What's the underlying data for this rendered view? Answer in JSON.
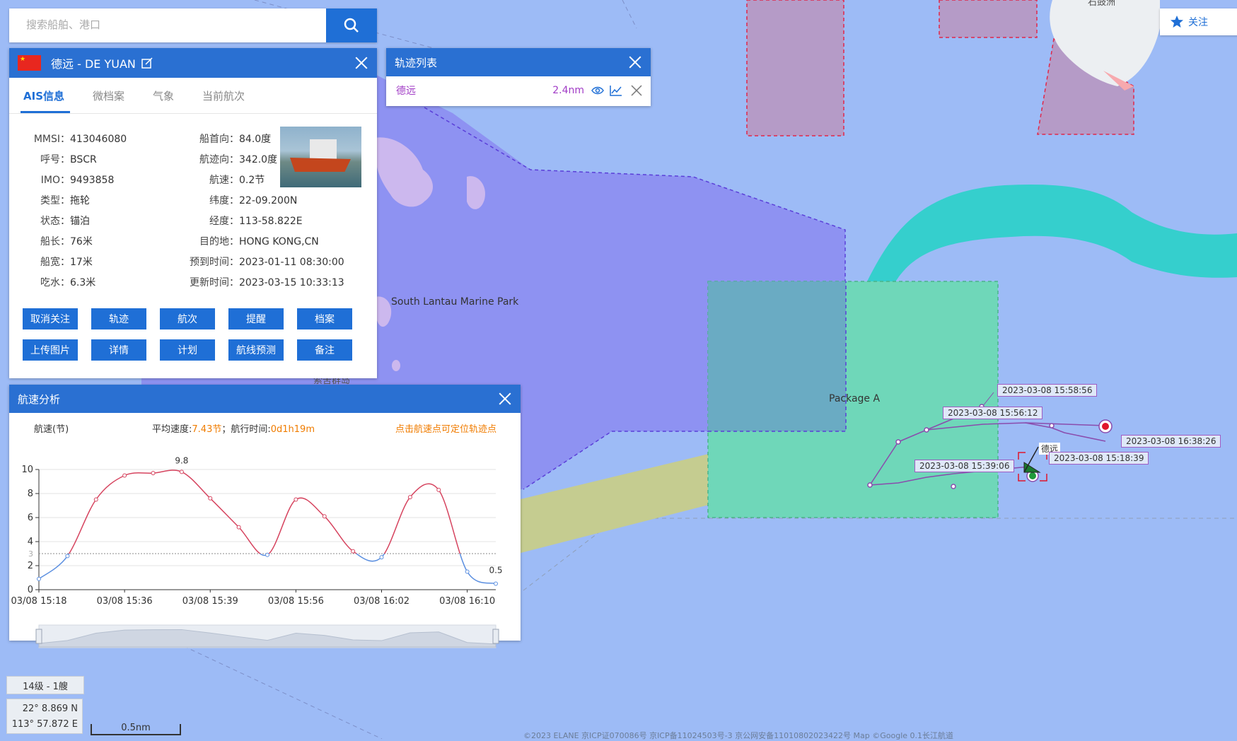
{
  "search": {
    "placeholder": "搜索船舶、港口"
  },
  "ship_panel": {
    "title": "德远 -  DE YUAN",
    "tabs": [
      "AIS信息",
      "微档案",
      "气象",
      "当前航次"
    ],
    "fields": {
      "mmsi": {
        "label": "MMSI：",
        "value": "413046080"
      },
      "callsign": {
        "label": "呼号：",
        "value": "BSCR"
      },
      "imo": {
        "label": "IMO：",
        "value": "9493858"
      },
      "type": {
        "label": "类型：",
        "value": "拖轮"
      },
      "status": {
        "label": "状态：",
        "value": "锚泊"
      },
      "length": {
        "label": "船长：",
        "value": "76米"
      },
      "beam": {
        "label": "船宽：",
        "value": "17米"
      },
      "draft": {
        "label": "吃水：",
        "value": "6.3米"
      },
      "heading": {
        "label": "船首向：",
        "value": "84.0度"
      },
      "course": {
        "label": "航迹向：",
        "value": "342.0度"
      },
      "speed": {
        "label": "航速：",
        "value": "0.2节"
      },
      "lat": {
        "label": "纬度：",
        "value": "22-09.200N"
      },
      "lon": {
        "label": "经度：",
        "value": "113-58.822E"
      },
      "destination": {
        "label": "目的地：",
        "value": "HONG KONG,CN"
      },
      "eta": {
        "label": "预到时间：",
        "value": "2023-01-11 08:30:00"
      },
      "updated": {
        "label": "更新时间：",
        "value": "2023-03-15 10:33:13"
      }
    },
    "buttons": [
      "取消关注",
      "轨迹",
      "航次",
      "提醒",
      "档案",
      "上传图片",
      "详情",
      "计划",
      "航线预测",
      "备注"
    ]
  },
  "track_list": {
    "title": "轨迹列表",
    "items": [
      {
        "name": "德远",
        "distance": "2.4nm"
      }
    ]
  },
  "speed_analysis": {
    "title": "航速分析",
    "ylabel": "航速(节)",
    "avg_label": "平均速度:",
    "avg_value": "7.43节",
    "duration_label": "航行时间:",
    "duration_value": "0d1h19m",
    "separator": "；",
    "hint": "点击航速点可定位轨迹点"
  },
  "chart_data": {
    "type": "line",
    "xlabel": "",
    "ylabel": "航速(节)",
    "ylim": [
      0,
      10
    ],
    "yticks": [
      0,
      2,
      4,
      6,
      8,
      10
    ],
    "xtick_labels": [
      "03/08 15:18",
      "03/08 15:36",
      "03/08 15:39",
      "03/08 15:56",
      "03/08 16:02",
      "03/08 16:10"
    ],
    "x_index_range": [
      0,
      16
    ],
    "xtick_positions": [
      0,
      3,
      6,
      9,
      12,
      15
    ],
    "threshold": 3,
    "threshold_label": "3",
    "max_label": "9.8",
    "end_label": "0.5",
    "grid": true,
    "series": [
      {
        "x": [
          0,
          1,
          2,
          3,
          4,
          5,
          6,
          7,
          8,
          9,
          10,
          11,
          12,
          13,
          14,
          15,
          16
        ],
        "values": [
          0.9,
          2.8,
          7.5,
          9.5,
          9.7,
          9.8,
          7.6,
          5.2,
          2.9,
          7.5,
          6.1,
          3.2,
          2.7,
          7.7,
          8.3,
          1.5,
          0.5
        ]
      }
    ]
  },
  "map": {
    "follow_label": "关注",
    "place_south_lantau": "South Lantau Marine Park",
    "place_lantau_partial": "索罟群岛",
    "place_top_partial": "石鼓洲",
    "package_label": "Package A",
    "ship_label": "德远",
    "track_times": [
      "2023-03-08 15:58:56",
      "2023-03-08 15:56:12",
      "2023-03-08 16:38:26",
      "2023-03-08 15:39:06",
      "2023-03-08 15:18:39"
    ],
    "zoom_text": "14级 - 1艘",
    "coord_lat": "22° 8.869 N",
    "coord_lon": "113° 57.872 E",
    "scale_text": "0.5nm",
    "footer_text": "©2023 ELANE  京ICP证070086号  京ICP备11024503号-3  京公网安备11010802023422号  Map ©Google 0.1长江航道"
  }
}
